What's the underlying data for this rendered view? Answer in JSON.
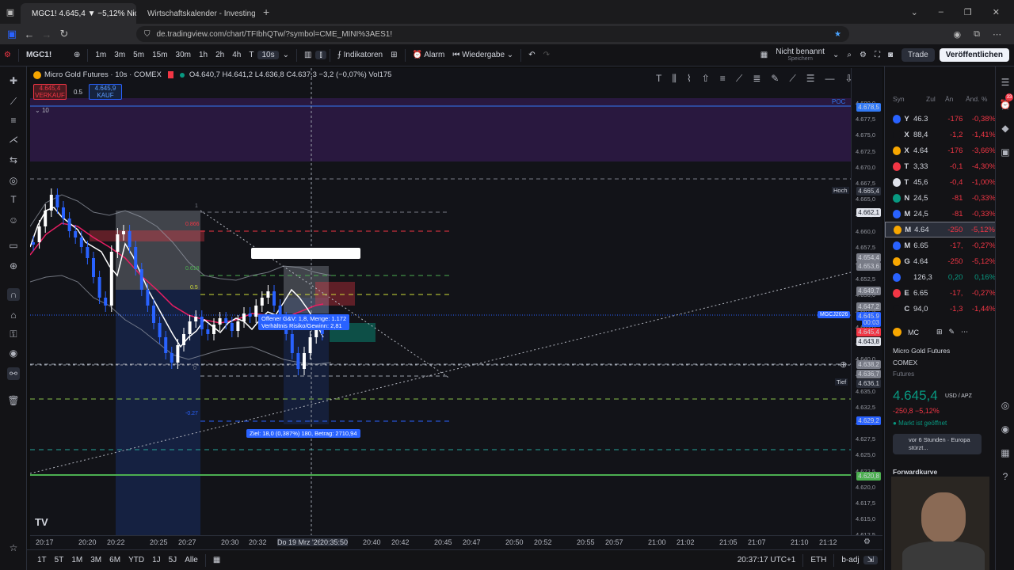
{
  "browser": {
    "tabs": [
      {
        "label": "MGC1! 4.645,4 ▼ −5,12% Nicht",
        "close": "✕"
      },
      {
        "label": "Wirtschaftskalender - Investing",
        "close": "✕"
      }
    ],
    "new_tab": "+",
    "url": "de.tradingview.com/chart/TFIbhQTw/?symbol=CME_MINI%3AES1!"
  },
  "toolbar": {
    "symbol": "MGC1!",
    "intervals": [
      "1m",
      "3m",
      "5m",
      "15m",
      "30m",
      "1h",
      "2h",
      "4h",
      "T",
      "10s"
    ],
    "indicators": "Indikatoren",
    "alarm": "Alarm",
    "replay": "Wiedergabe",
    "layout_name": "Nicht benannt",
    "layout_sub": "Speichern",
    "trade": "Trade",
    "publish": "Veröffentlichen"
  },
  "legend": {
    "title": "Micro Gold Futures · 10s · COMEX",
    "ohlc": "O4.640,7 H4.641,2 L4.636,8 C4.637,3 −3,2 (−0,07%) Vol175",
    "sell_price": "4.645,4",
    "sell_label": "VERKAUF",
    "spread": "0.5",
    "buy_price": "4.645,9",
    "buy_label": "KAUF",
    "collapse": "10"
  },
  "chart_overlays": {
    "poc": "POC",
    "info_box": [
      "Offener G&V: 1,8, Menge: 1.172",
      "Verhältnis Risiko/Gewinn: 2,81"
    ],
    "target_box": "Ziel: 18,0 (0,387%) 180, Betrag: 2710,94",
    "symbol_tag": "MGCJ2026",
    "high_label": "Hoch",
    "low_label": "Tief",
    "small_labels": [
      "1",
      "0.866",
      "0.618",
      "0.5",
      "0",
      "-0.27"
    ],
    "watermark": "TV"
  },
  "price_axis": {
    "ticks": [
      "4.680,0",
      "4.677,5",
      "4.675,0",
      "4.672,5",
      "4.670,0",
      "4.667,5",
      "4.665,0",
      "4.662,5",
      "4.660,0",
      "4.657,5",
      "4.655,0",
      "4.652,5",
      "4.650,0",
      "4.647,5",
      "4.645,0",
      "4.642,5",
      "4.640,0",
      "4.637,5",
      "4.635,0",
      "4.632,5",
      "4.630,0",
      "4.627,5",
      "4.625,0",
      "4.622,5",
      "4.620,0",
      "4.617,5",
      "4.615,0",
      "4.612,5"
    ],
    "labels": [
      {
        "text": "4.678,5",
        "color": "#3179f5"
      },
      {
        "text": "4.665,4",
        "color": "#2a2e39"
      },
      {
        "text": "4.662,1",
        "color": "#e0e3eb"
      },
      {
        "text": "4.654,4",
        "color": "#787b86"
      },
      {
        "text": "4.653,6",
        "color": "#787b86"
      },
      {
        "text": "4.649,7",
        "color": "#787b86"
      },
      {
        "text": "4.647,2",
        "color": "#787b86"
      },
      {
        "text": "4.645,9",
        "color": "#2962ff"
      },
      {
        "text": "00:03",
        "color": "#2962ff"
      },
      {
        "text": "4.645,4",
        "color": "#f23645"
      },
      {
        "text": "4.643,8",
        "color": "#e0e3eb"
      },
      {
        "text": "4.638,2",
        "color": "#787b86"
      },
      {
        "text": "4.636,7",
        "color": "#787b86"
      },
      {
        "text": "4.636,1",
        "color": "#2a2e39"
      },
      {
        "text": "4.629,2",
        "color": "#2962ff"
      },
      {
        "text": "4.620,8",
        "color": "#4caf50"
      }
    ]
  },
  "time_axis": {
    "ticks": [
      "20:17",
      "20:20",
      "20:22",
      "20:25",
      "20:27",
      "20:30",
      "20:32",
      "Do 19 Mrz '26",
      "20:35:50",
      "20:40",
      "20:42",
      "20:45",
      "20:47",
      "20:50",
      "20:52",
      "20:55",
      "20:57",
      "21:00",
      "21:02",
      "21:05",
      "21:07",
      "21:10",
      "21:12"
    ]
  },
  "bottom": {
    "ranges": [
      "1T",
      "5T",
      "1M",
      "3M",
      "6M",
      "YTD",
      "1J",
      "5J",
      "Alle"
    ],
    "clock": "20:37:17 UTC+1",
    "session": "ETH",
    "adj": "b-adj"
  },
  "watchlist": {
    "headers": [
      "Syn",
      "Zul",
      "Än",
      "Änd. %"
    ],
    "rows": [
      {
        "sym": "Y",
        "last": "46.3",
        "chg": "-176",
        "pct": "-0,38%",
        "color": "#2962ff"
      },
      {
        "sym": "X",
        "last": "88,4",
        "chg": "-1,2",
        "pct": "-1,41%",
        "color": "#131316"
      },
      {
        "sym": "X",
        "last": "4.64",
        "chg": "-176",
        "pct": "-3,66%",
        "color": "#f7a600"
      },
      {
        "sym": "T",
        "last": "3,33",
        "chg": "-0,1",
        "pct": "-4,30%",
        "color": "#f23645"
      },
      {
        "sym": "T",
        "last": "45,6",
        "chg": "-0,4",
        "pct": "-1,00%",
        "color": "#e0e3eb"
      },
      {
        "sym": "N",
        "last": "24,5",
        "chg": "-81",
        "pct": "-0,33%",
        "color": "#089981"
      },
      {
        "sym": "M",
        "last": "24,5",
        "chg": "-81",
        "pct": "-0,33%",
        "color": "#2962ff"
      },
      {
        "sym": "M",
        "last": "4.64",
        "chg": "-250",
        "pct": "-5,12%",
        "color": "#f7a600"
      },
      {
        "sym": "M",
        "last": "6.65",
        "chg": "-17,",
        "pct": "-0,27%",
        "color": "#2962ff"
      },
      {
        "sym": "G",
        "last": "4.64",
        "chg": "-250",
        "pct": "-5,12%",
        "color": "#f7a600"
      },
      {
        "sym": "",
        "last": "126,3",
        "chg": "0,20",
        "pct": "0,16%",
        "color": "#2962ff"
      },
      {
        "sym": "E",
        "last": "6.65",
        "chg": "-17,",
        "pct": "-0,27%",
        "color": "#f23645"
      },
      {
        "sym": "C",
        "last": "94,0",
        "chg": "-1,3",
        "pct": "-1,44%",
        "color": "#131316"
      }
    ],
    "detail_sym": "MC",
    "detail_name": "Micro Gold Futures",
    "exchange": "COMEX",
    "type": "Futures",
    "price": "4.645,4",
    "currency": "USD / APZ",
    "change": "-250,8 −5,12%",
    "market_status": "Markt ist geöffnet",
    "news": "vor 6 Stunden · Europa stürzt...",
    "forward": "Forwardkurve"
  }
}
